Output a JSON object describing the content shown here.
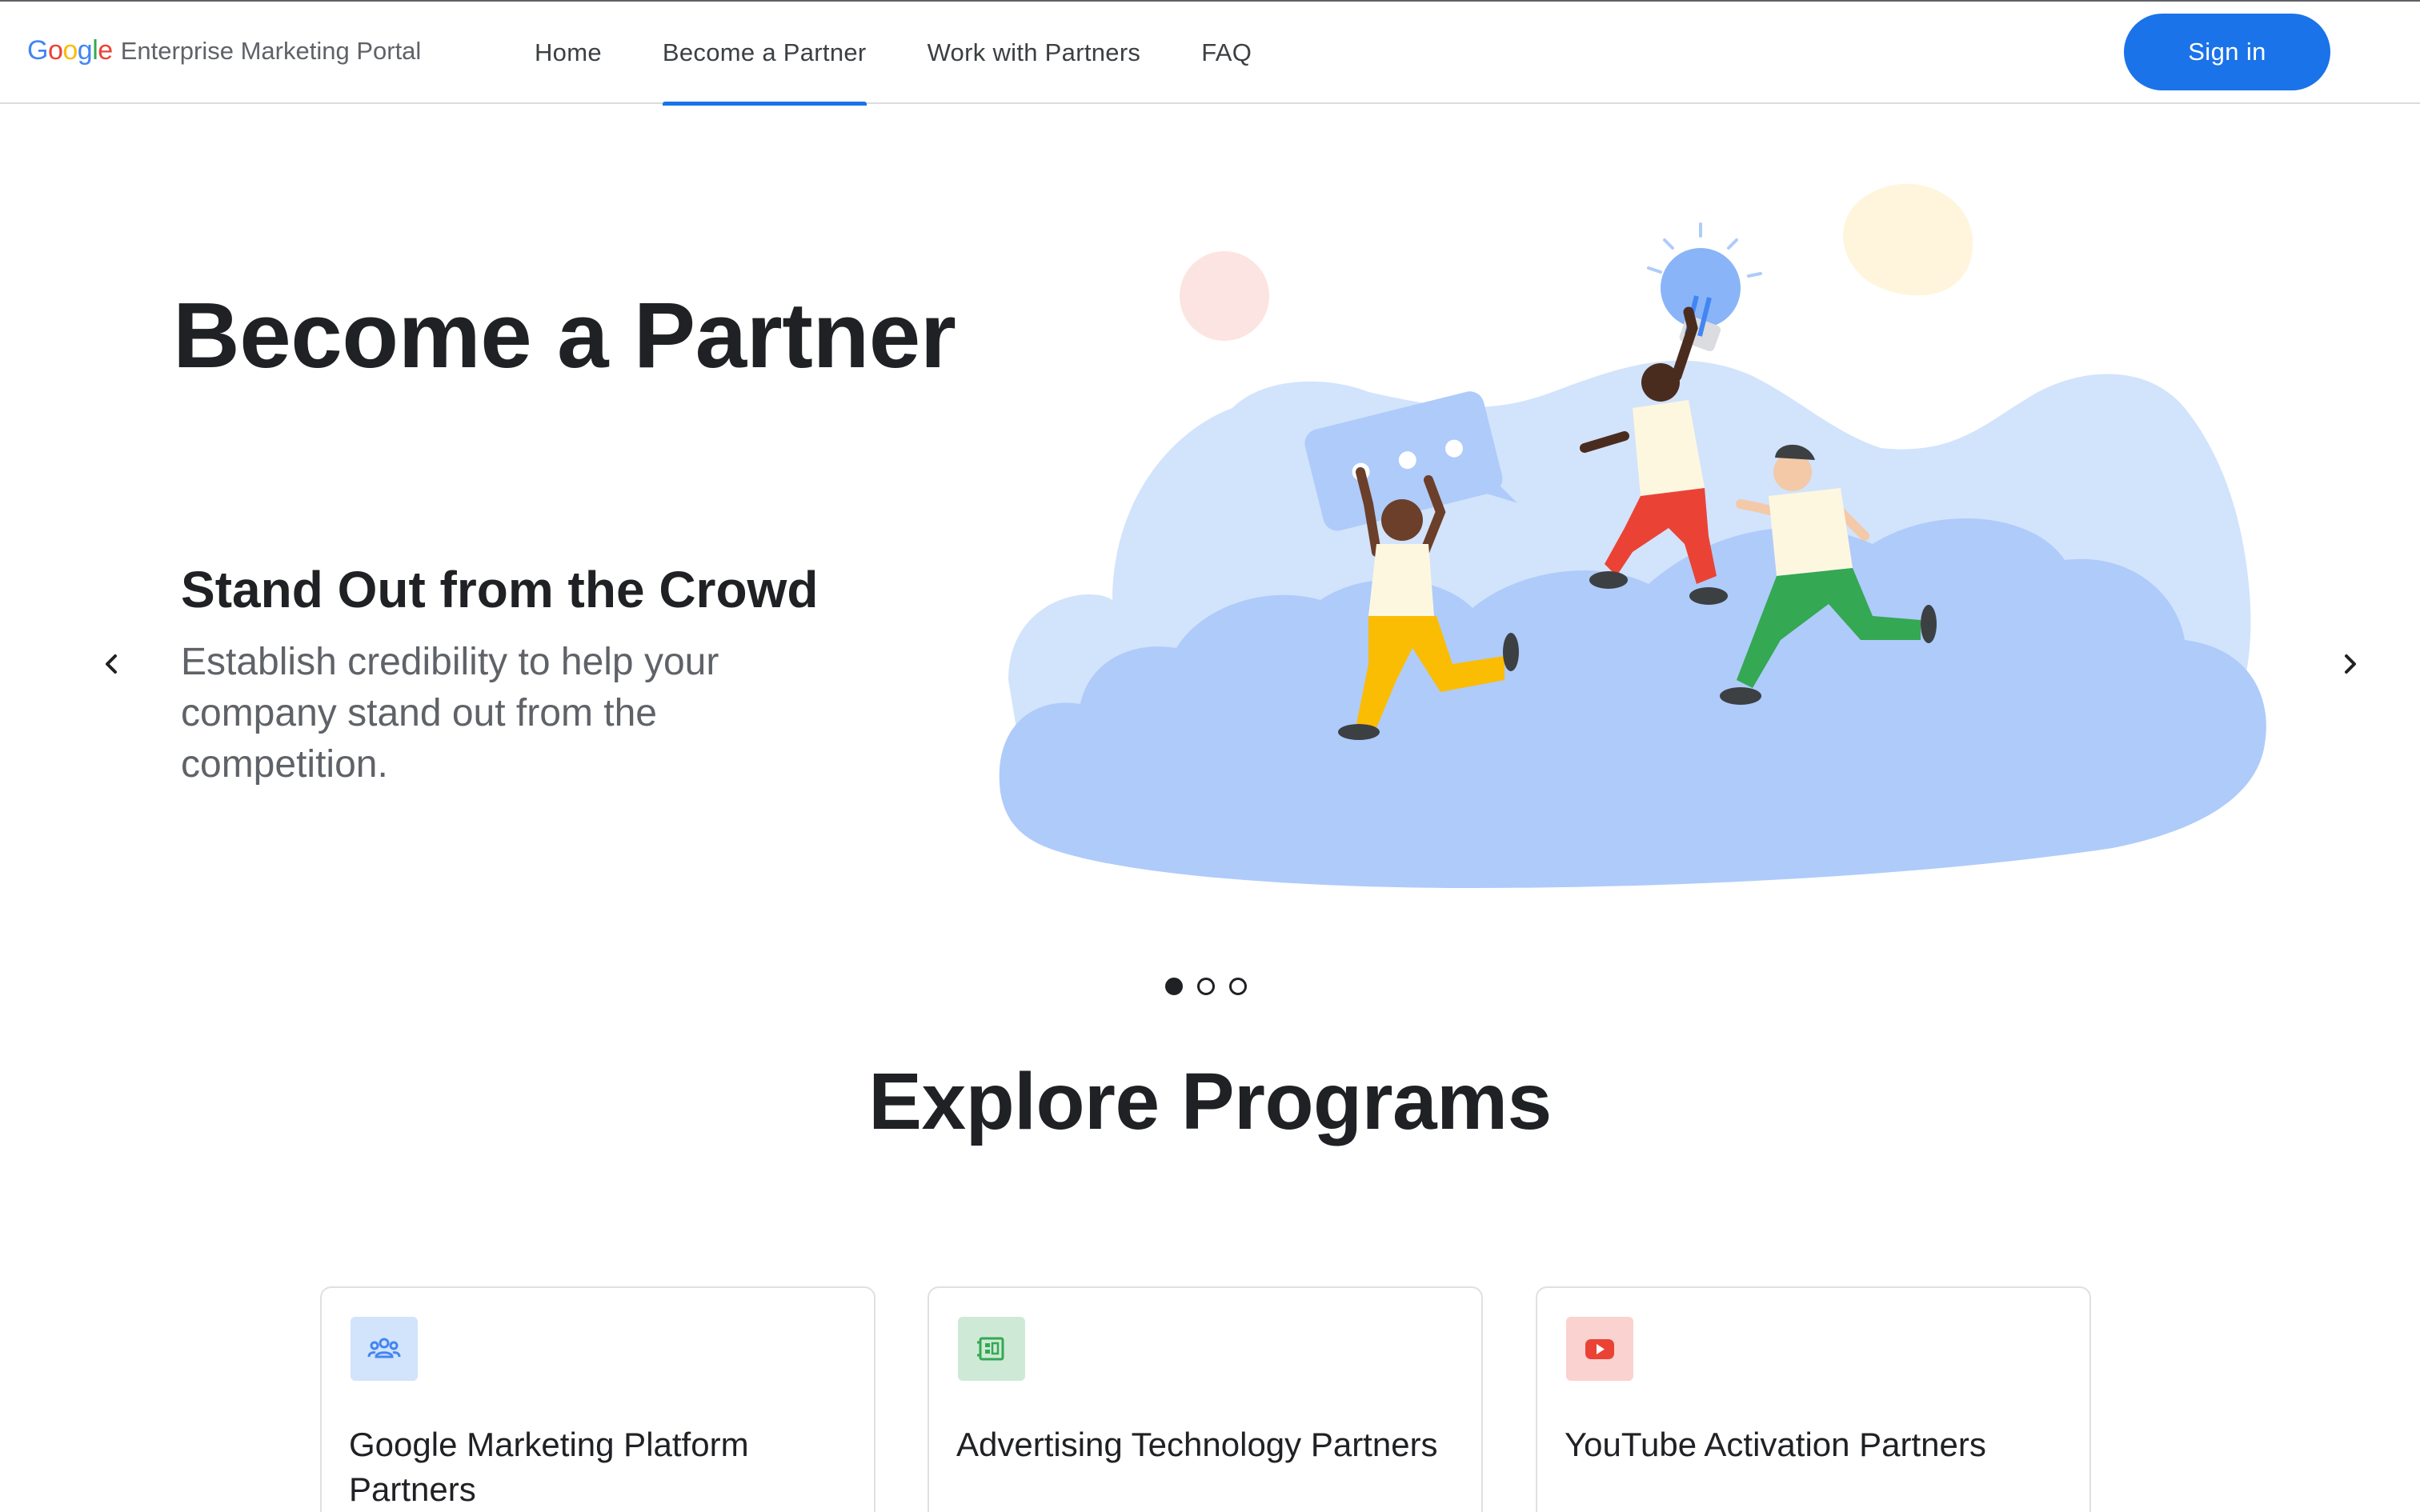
{
  "header": {
    "logo_google": "Google",
    "logo_portal": "Enterprise Marketing Portal",
    "nav": [
      {
        "label": "Home",
        "active": false
      },
      {
        "label": "Become a Partner",
        "active": true
      },
      {
        "label": "Work with Partners",
        "active": false
      },
      {
        "label": "FAQ",
        "active": false
      }
    ],
    "sign_in_label": "Sign in"
  },
  "hero": {
    "title": "Become a Partner",
    "slide": {
      "title": "Stand Out from the Crowd",
      "body": "Establish credibility to help your company stand out from the competition."
    },
    "carousel": {
      "total": 3,
      "active_index": 0
    },
    "prev_icon": "chevron-left-icon",
    "next_icon": "chevron-right-icon"
  },
  "programs": {
    "title": "Explore Programs",
    "cards": [
      {
        "title": "Google Marketing Platform Partners",
        "icon": "people-icon",
        "icon_bg": "#d2e3fc",
        "icon_color": "#4285f4"
      },
      {
        "title": "Advertising Technology Partners",
        "icon": "ad-tech-icon",
        "icon_bg": "#ceead6",
        "icon_color": "#34a853"
      },
      {
        "title": "YouTube Activation Partners",
        "icon": "youtube-icon",
        "icon_bg": "#fad2cf",
        "icon_color": "#ea4335"
      }
    ]
  },
  "colors": {
    "accent": "#1a73e8",
    "text_primary": "#202124",
    "text_secondary": "#5f6368"
  }
}
